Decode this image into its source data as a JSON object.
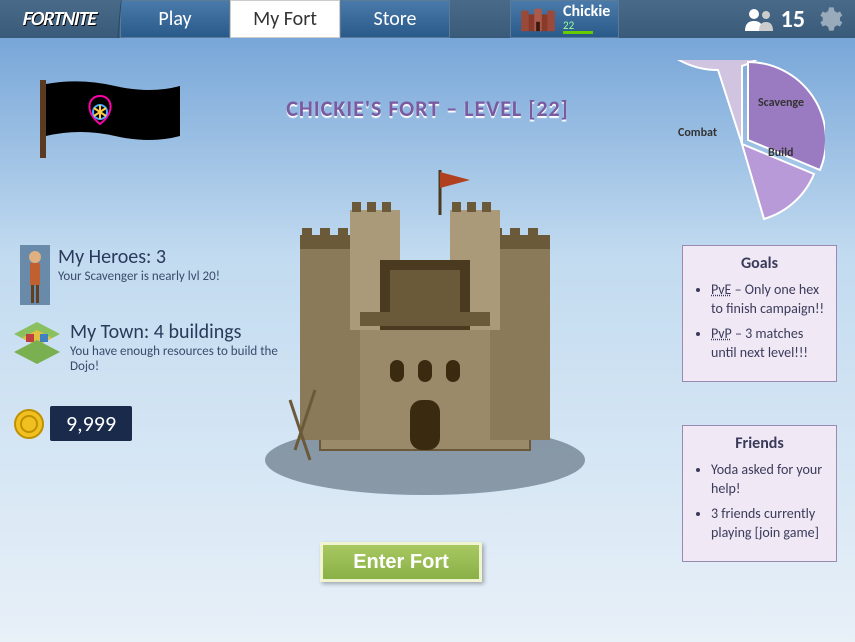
{
  "header": {
    "logo": "FORTNITE",
    "tabs": {
      "play": "Play",
      "myfort": "My Fort",
      "store": "Store"
    },
    "player": {
      "name": "Chickie",
      "level": "22"
    },
    "friend_count": "15"
  },
  "title": "CHICKIE'S FORT – LEVEL [22]",
  "heroes": {
    "heading": "My Heroes: 3",
    "sub": "Your Scavenger is nearly lvl 20!"
  },
  "town": {
    "heading": "My Town: 4 buildings",
    "sub": "You have enough resources to build the Dojo!"
  },
  "coins": "9,999",
  "enter_button": "Enter Fort",
  "pie": {
    "slices": [
      {
        "label": "Combat",
        "value": 55
      },
      {
        "label": "Scavenge",
        "value": 28
      },
      {
        "label": "Build",
        "value": 17
      }
    ]
  },
  "goals": {
    "title": "Goals",
    "items": [
      {
        "tag": "PvE",
        "text": " – Only one hex to finish campaign!!"
      },
      {
        "tag": "PvP",
        "text": " – 3 matches until next level!!!"
      }
    ]
  },
  "friends": {
    "title": "Friends",
    "items": [
      "Yoda asked for your help!",
      "3 friends currently playing [join game]"
    ]
  },
  "chart_data": {
    "type": "pie",
    "title": "",
    "series": [
      {
        "name": "Combat",
        "value": 55
      },
      {
        "name": "Scavenge",
        "value": 28
      },
      {
        "name": "Build",
        "value": 17
      }
    ]
  }
}
